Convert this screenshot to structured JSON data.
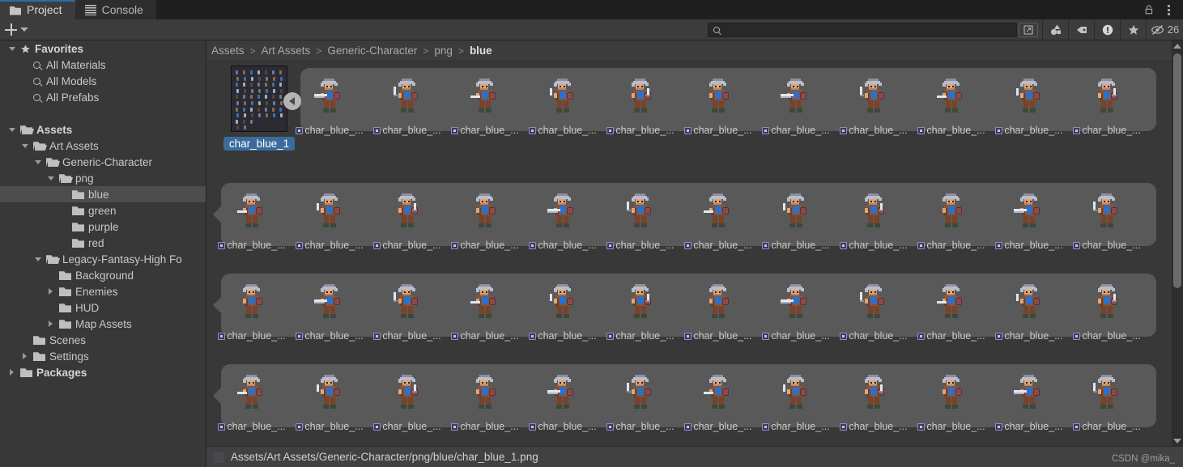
{
  "window": {
    "tabs": [
      {
        "label": "Project",
        "icon": "folder-icon",
        "active": true
      },
      {
        "label": "Console",
        "icon": "console-icon",
        "active": false
      }
    ],
    "lock_icon": "lock-icon",
    "menu_icon": "kebab-menu-icon"
  },
  "toolbar": {
    "create_label": "+",
    "create_icon": "plus-icon",
    "create_dropdown_icon": "chevron-down-icon",
    "search": {
      "value": "",
      "placeholder": "",
      "icon": "search-icon"
    },
    "buttons": [
      {
        "name": "search-scope-icon",
        "icon": "expand-search-icon"
      },
      {
        "name": "filter-by-type-icon",
        "icon": "shapes-icon"
      },
      {
        "name": "filter-by-label-icon",
        "icon": "tag-icon"
      },
      {
        "name": "filter-warnings-icon",
        "icon": "warning-icon"
      },
      {
        "name": "filter-favorites-icon",
        "icon": "star-icon"
      }
    ],
    "hidden_count": "26",
    "hidden_icon": "eye-off-icon"
  },
  "sidebar": {
    "items": [
      {
        "label": "Favorites",
        "indent": 0,
        "arrow": "down",
        "icon": "star-icon",
        "bold": true,
        "selected": false
      },
      {
        "label": "All Materials",
        "indent": 1,
        "arrow": "none",
        "icon": "search-icon",
        "bold": false,
        "selected": false
      },
      {
        "label": "All Models",
        "indent": 1,
        "arrow": "none",
        "icon": "search-icon",
        "bold": false,
        "selected": false
      },
      {
        "label": "All Prefabs",
        "indent": 1,
        "arrow": "none",
        "icon": "search-icon",
        "bold": false,
        "selected": false
      },
      {
        "label": "",
        "indent": 0,
        "arrow": "none",
        "icon": "none",
        "bold": false,
        "selected": false
      },
      {
        "label": "Assets",
        "indent": 0,
        "arrow": "down",
        "icon": "folder-open-icon",
        "bold": true,
        "selected": false
      },
      {
        "label": "Art Assets",
        "indent": 1,
        "arrow": "down",
        "icon": "folder-open-icon",
        "bold": false,
        "selected": false
      },
      {
        "label": "Generic-Character",
        "indent": 2,
        "arrow": "down",
        "icon": "folder-open-icon",
        "bold": false,
        "selected": false
      },
      {
        "label": "png",
        "indent": 3,
        "arrow": "down",
        "icon": "folder-open-icon",
        "bold": false,
        "selected": false
      },
      {
        "label": "blue",
        "indent": 4,
        "arrow": "none",
        "icon": "folder-icon",
        "bold": false,
        "selected": true
      },
      {
        "label": "green",
        "indent": 4,
        "arrow": "none",
        "icon": "folder-icon",
        "bold": false,
        "selected": false
      },
      {
        "label": "purple",
        "indent": 4,
        "arrow": "none",
        "icon": "folder-icon",
        "bold": false,
        "selected": false
      },
      {
        "label": "red",
        "indent": 4,
        "arrow": "none",
        "icon": "folder-icon",
        "bold": false,
        "selected": false
      },
      {
        "label": "Legacy-Fantasy-High Fo",
        "indent": 2,
        "arrow": "down",
        "icon": "folder-open-icon",
        "bold": false,
        "selected": false
      },
      {
        "label": "Background",
        "indent": 3,
        "arrow": "none",
        "icon": "folder-icon",
        "bold": false,
        "selected": false
      },
      {
        "label": "Enemies",
        "indent": 3,
        "arrow": "right",
        "icon": "folder-icon",
        "bold": false,
        "selected": false
      },
      {
        "label": "HUD",
        "indent": 3,
        "arrow": "none",
        "icon": "folder-icon",
        "bold": false,
        "selected": false
      },
      {
        "label": "Map Assets",
        "indent": 3,
        "arrow": "right",
        "icon": "folder-icon",
        "bold": false,
        "selected": false
      },
      {
        "label": "Scenes",
        "indent": 1,
        "arrow": "none",
        "icon": "folder-icon",
        "bold": false,
        "selected": false
      },
      {
        "label": "Settings",
        "indent": 1,
        "arrow": "right",
        "icon": "folder-icon",
        "bold": false,
        "selected": false
      },
      {
        "label": "Packages",
        "indent": 0,
        "arrow": "right",
        "icon": "folder-icon",
        "bold": true,
        "selected": false
      }
    ]
  },
  "breadcrumb": {
    "segments": [
      "Assets",
      "Art Assets",
      "Generic-Character",
      "png",
      "blue"
    ],
    "separator": ">"
  },
  "grid": {
    "root_asset": {
      "name": "char_blue_1",
      "icon": "sprite-sheet-icon",
      "selected": true
    },
    "collapse_icon": "collapse-left-arrow-icon",
    "sub_asset_label": "char_blue_...",
    "sub_asset_icon": "sprite-icon",
    "rows": [
      {
        "count": 12,
        "first_is_sheet": true
      },
      {
        "count": 12,
        "first_is_sheet": false
      },
      {
        "count": 12,
        "first_is_sheet": false
      },
      {
        "count": 12,
        "first_is_sheet": false
      }
    ]
  },
  "scrollbar": {
    "up_icon": "scroll-up-arrow-icon",
    "down_icon": "scroll-down-arrow-icon",
    "thumb_position_pct": 3,
    "thumb_size_pct": 60
  },
  "status": {
    "path": "Assets/Art Assets/Generic-Character/png/blue/char_blue_1.png",
    "icon": "sprite-sheet-icon"
  },
  "watermark": {
    "text": "CSDN @mika_"
  },
  "colors": {
    "window_bg": "#383838",
    "panel_bg": "#3c3c3c",
    "tabbar_bg": "#1f1f1f",
    "selection_blue": "#3a6c9b",
    "row_band": "#595959",
    "tree_selected": "#4d4d4d",
    "text": "#c8c8c8",
    "accent_tab_top": "#2b6ba8"
  }
}
